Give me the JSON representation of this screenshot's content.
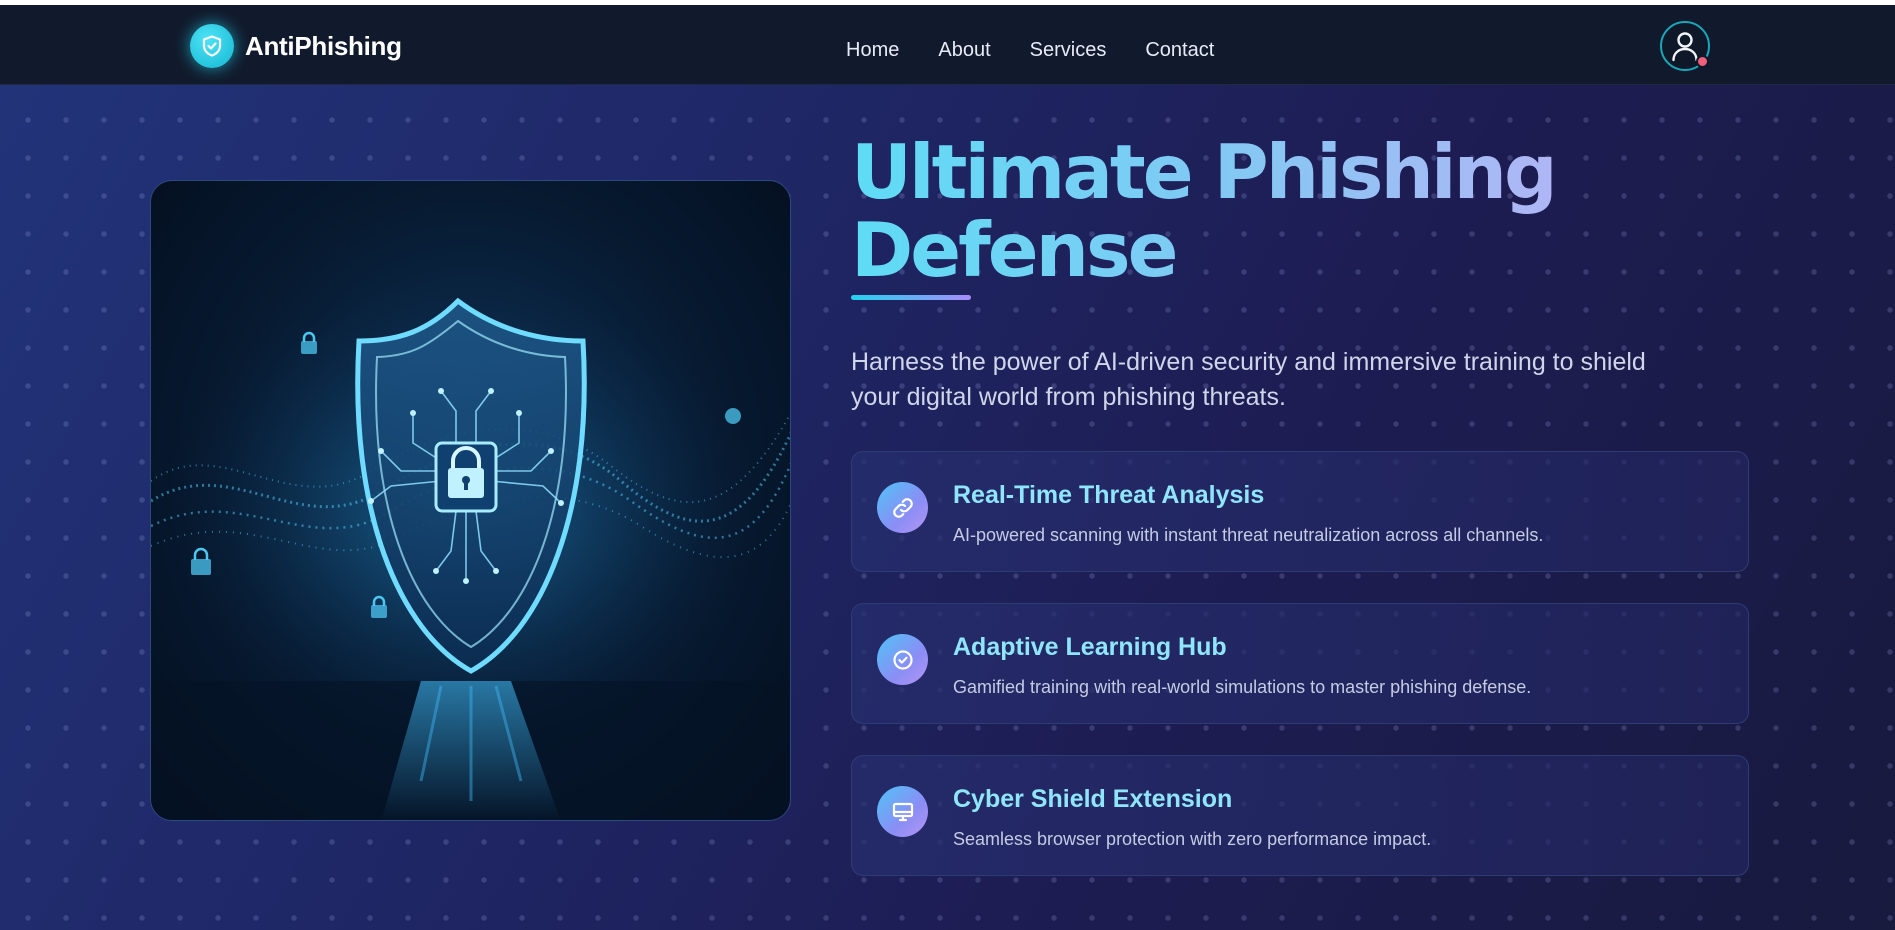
{
  "nav": {
    "brand": "AntiPhishing",
    "links": [
      "Home",
      "About",
      "Services",
      "Contact"
    ]
  },
  "hero": {
    "title_line1": "Ultimate Phishing",
    "title_line2": "Defense",
    "subtitle_line1": "Harness the power of AI-driven security and immersive training to shield",
    "subtitle_line2": "your digital world from phishing threats.",
    "image_alt": "glowing-shield-with-padlock"
  },
  "features": [
    {
      "icon": "link-icon",
      "title": "Real-Time Threat Analysis",
      "description": "AI-powered scanning with instant threat neutralization across all channels."
    },
    {
      "icon": "check-circle-icon",
      "title": "Adaptive Learning Hub",
      "description": "Gamified training with real-world simulations to master phishing defense."
    },
    {
      "icon": "monitor-icon",
      "title": "Cyber Shield Extension",
      "description": "Seamless browser protection with zero performance impact."
    }
  ],
  "colors": {
    "nav_bg": "#111a2c",
    "accent_cyan": "#22d3ee",
    "accent_violet": "#a78bfa",
    "card_title": "#8fe6fa",
    "notification": "#f0607a"
  }
}
